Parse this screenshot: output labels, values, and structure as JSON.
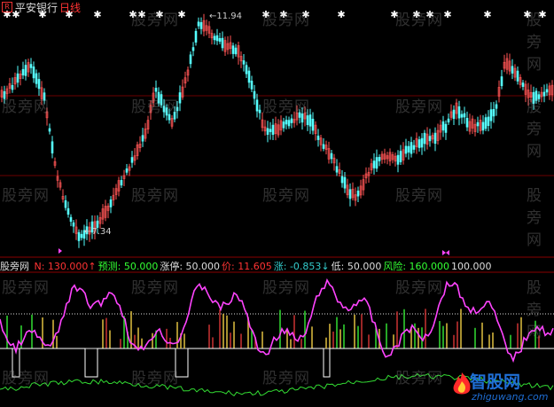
{
  "header": {
    "stock_name": "平安银行",
    "period": "日线",
    "high_label": "11.94",
    "low_label": "7.34"
  },
  "watermark_text": "股旁网",
  "indicator": {
    "name": "股旁网",
    "items": [
      {
        "label": "N: ",
        "value": "130.000↑",
        "color": "#ff3333"
      },
      {
        "label": "预测: ",
        "value": "50.000",
        "color": "#33ff33"
      },
      {
        "label": "涨停: ",
        "value": "50.000",
        "color": "#dddddd"
      },
      {
        "label": "价: ",
        "value": "11.605",
        "color": "#ff3333"
      },
      {
        "label": "涨: ",
        "value": "-0.853↓",
        "color": "#33cccc"
      },
      {
        "label": "低: ",
        "value": "50.000",
        "color": "#dddddd"
      },
      {
        "label": "风险: ",
        "value": "160.000",
        "color": "#33ff33"
      },
      {
        "label": "",
        "value": "100.000",
        "color": "#dddddd"
      }
    ]
  },
  "logo": {
    "brand": "智股网",
    "domain": "zhiguwang.com"
  },
  "colors": {
    "up_candle": "#ff5555",
    "down_candle": "#55ffff",
    "oscillator": "#ff44ff",
    "green_line": "#33dd33",
    "yellow_bar": "#e0c040",
    "grid_red": "#6b0000"
  }
}
